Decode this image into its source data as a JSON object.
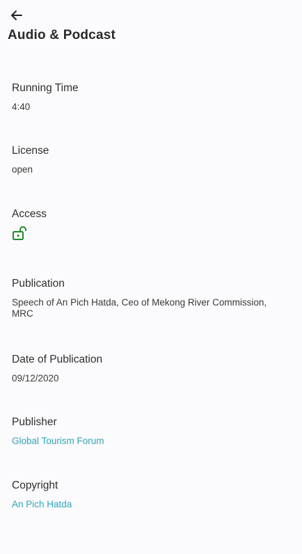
{
  "header": {
    "title": "Audio & Podcast"
  },
  "details": {
    "running_time": {
      "label": "Running Time",
      "value": "4:40"
    },
    "license": {
      "label": "License",
      "value": "open"
    },
    "access": {
      "label": "Access",
      "icon": "unlocked-lock-icon",
      "icon_color": "#1e8a2c"
    },
    "publication": {
      "label": "Publication",
      "value": "Speech of An Pich Hatda, Ceo of Mekong River Commission, MRC"
    },
    "date_of_publication": {
      "label": "Date of Publication",
      "value": "09/12/2020"
    },
    "publisher": {
      "label": "Publisher",
      "value": "Global Tourism Forum"
    },
    "copyright": {
      "label": "Copyright",
      "value": "An Pich Hatda"
    }
  },
  "colors": {
    "link": "#2fa6b8",
    "background": "#fbfafc"
  }
}
